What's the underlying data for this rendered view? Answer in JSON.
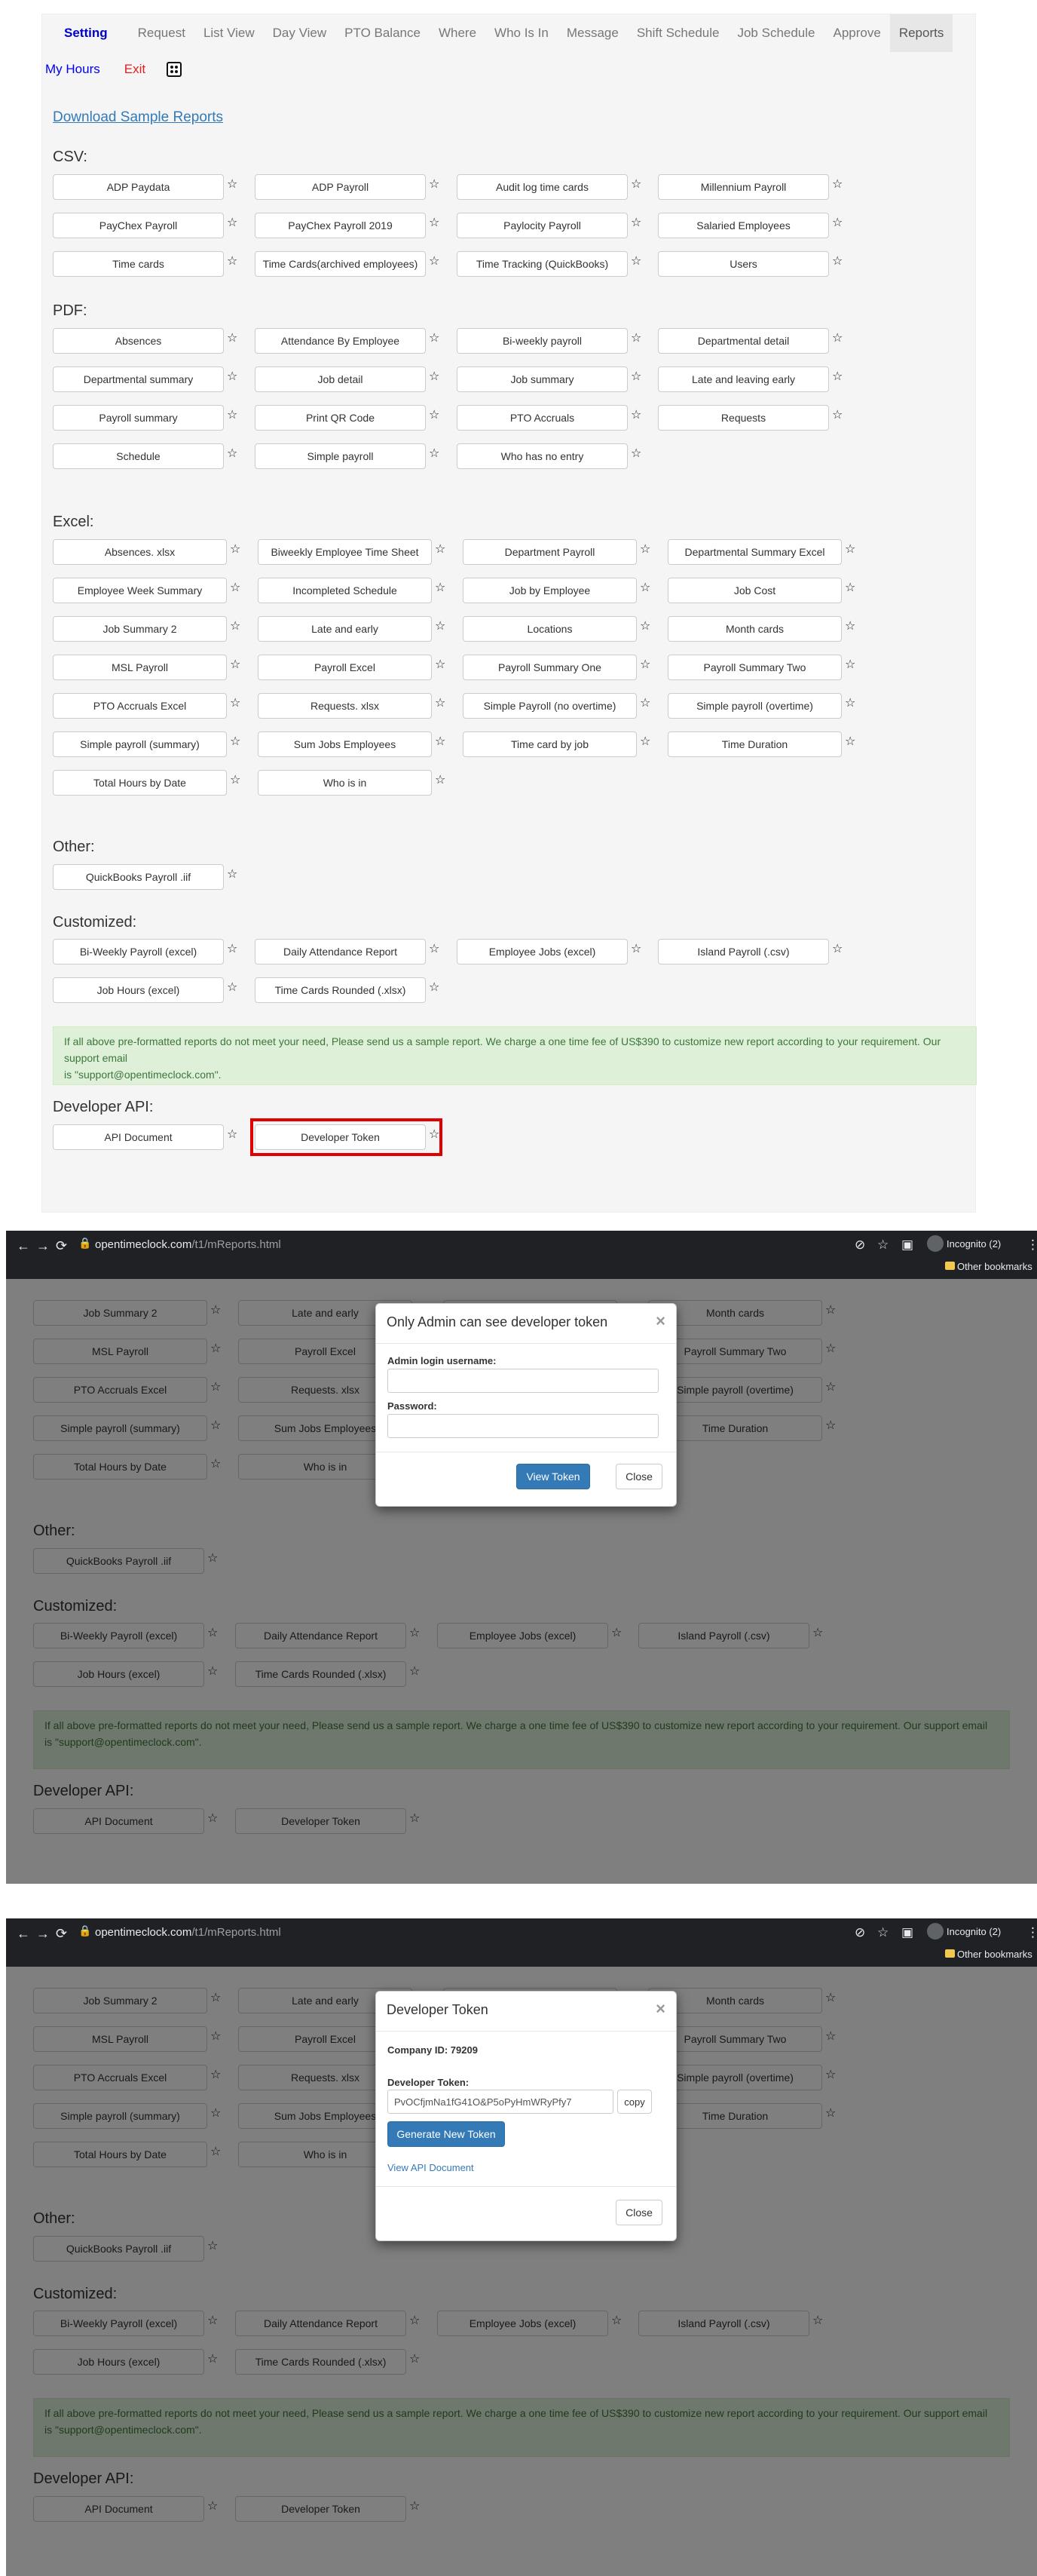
{
  "nav": {
    "brand": "Setting",
    "items": [
      "Request",
      "List View",
      "Day View",
      "PTO Balance",
      "Where",
      "Who Is In",
      "Message",
      "Shift Schedule",
      "Job Schedule",
      "Approve",
      "Reports"
    ],
    "active": "Reports",
    "my_hours": "My Hours",
    "exit": "Exit",
    "dice_icon": "dice-icon"
  },
  "download_link": "Download Sample Reports",
  "star_glyph": "☆",
  "sections": {
    "csv": {
      "title": "CSV:",
      "items": [
        "ADP Paydata",
        "ADP Payroll",
        "Audit log time cards",
        "Millennium Payroll",
        "PayChex Payroll",
        "PayChex Payroll 2019",
        "Paylocity Payroll",
        "Salaried Employees",
        "Time cards",
        "Time Cards(archived employees)",
        "Time Tracking (QuickBooks)",
        "Users"
      ]
    },
    "pdf": {
      "title": "PDF:",
      "items": [
        "Absences",
        "Attendance By Employee",
        "Bi-weekly payroll",
        "Departmental detail",
        "Departmental summary",
        "Job detail",
        "Job summary",
        "Late and leaving early",
        "Payroll summary",
        "Print QR Code",
        "PTO Accruals",
        "Requests",
        "Schedule",
        "Simple payroll",
        "Who has no entry"
      ]
    },
    "excel": {
      "title": "Excel:",
      "items": [
        "Absences. xlsx",
        "Biweekly Employee Time Sheet",
        "Department Payroll",
        "Departmental Summary Excel",
        "Employee Week Summary",
        "Incompleted Schedule",
        "Job by Employee",
        "Job Cost",
        "Job Summary 2",
        "Late and early",
        "Locations",
        "Month cards",
        "MSL Payroll",
        "Payroll Excel",
        "Payroll Summary One",
        "Payroll Summary Two",
        "PTO Accruals Excel",
        "Requests. xlsx",
        "Simple Payroll (no overtime)",
        "Simple payroll (overtime)",
        "Simple payroll (summary)",
        "Sum Jobs Employees",
        "Time card by job",
        "Time Duration",
        "Total Hours by Date",
        "Who is in"
      ]
    },
    "other": {
      "title": "Other:",
      "items": [
        "QuickBooks Payroll .iif"
      ]
    },
    "customized": {
      "title": "Customized:",
      "items": [
        "Bi-Weekly Payroll (excel)",
        "Daily Attendance Report",
        "Employee Jobs (excel)",
        "Island Payroll (.csv)",
        "Job Hours (excel)",
        "Time Cards Rounded (.xlsx)"
      ]
    },
    "developer": {
      "title": "Developer API:",
      "items": [
        "API Document",
        "Developer Token"
      ]
    }
  },
  "alert_line1": "If all above pre-formatted reports do not meet your need, Please send us a sample report. We charge a one time fee of US$390 to customize new report according to your requirement. Our support email",
  "alert_line2": "is \"support@opentimeclock.com\".",
  "browser": {
    "url_host": "opentimeclock.com",
    "url_path": "/t1/mReports.html",
    "incognito": "Incognito (2)",
    "bookmarks": "Other bookmarks"
  },
  "modal1": {
    "title": "Only Admin can see developer token",
    "username_label": "Admin login username:",
    "username_value": "",
    "password_label": "Password:",
    "password_value": "",
    "view_token": "View Token",
    "close": "Close"
  },
  "modal2": {
    "title": "Developer Token",
    "company_id": "Company ID: 79209",
    "token_label": "Developer Token:",
    "token_value": "PvOCfjmNa1fG41O&P5oPyHmWRyPfy7",
    "copy": "copy",
    "generate": "Generate New Token",
    "view_api": "View API Document",
    "close": "Close"
  }
}
